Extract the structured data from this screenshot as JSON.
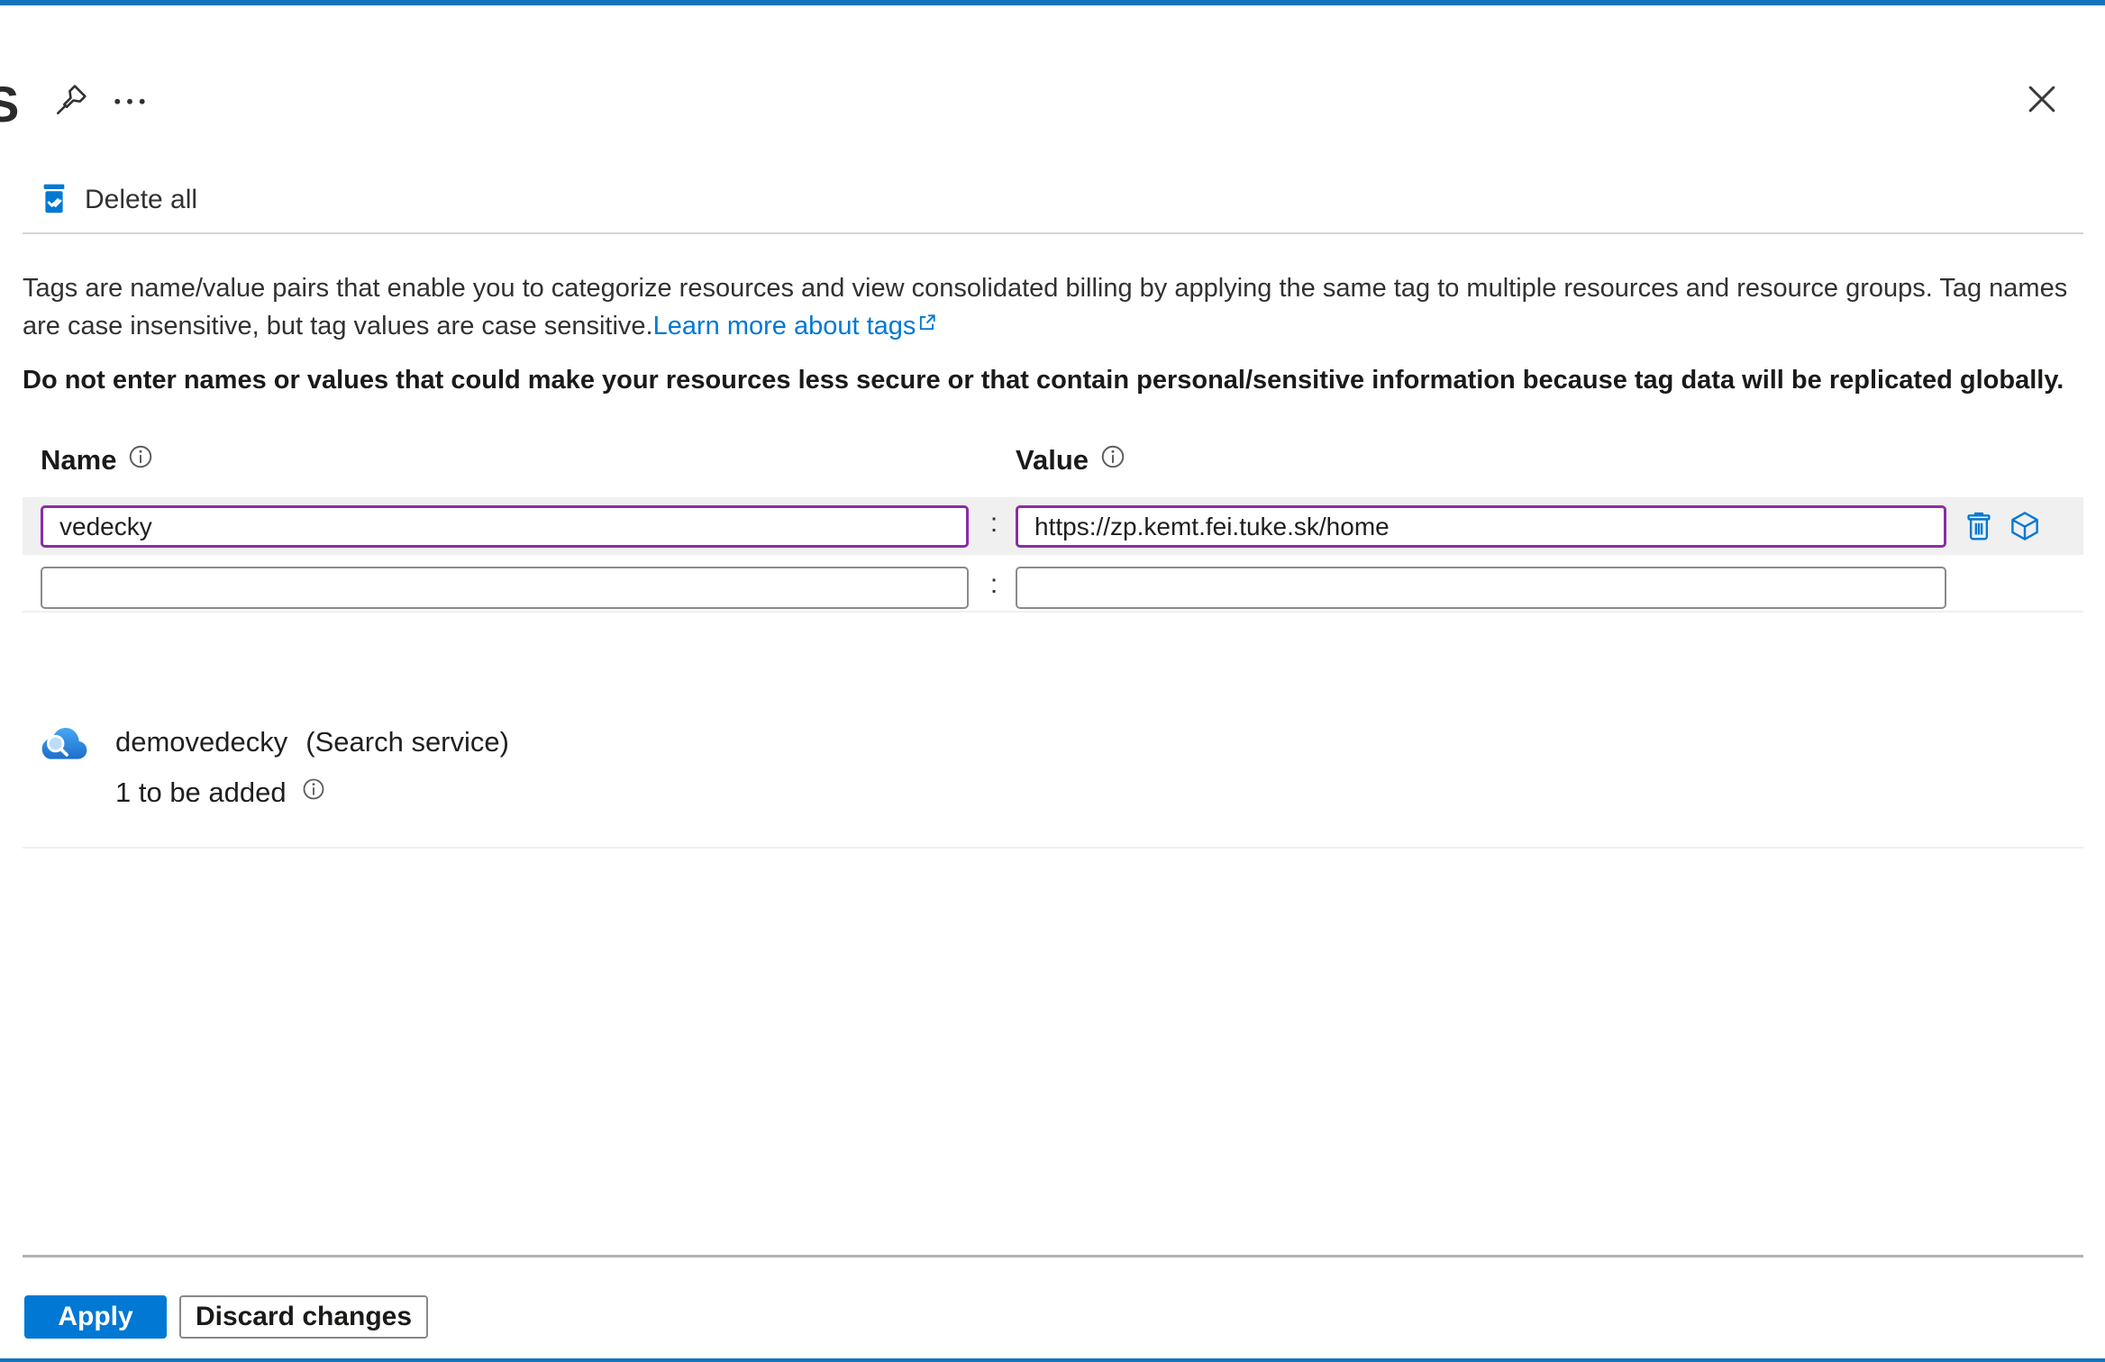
{
  "window": {
    "partial_title": "S",
    "topbar_color": "#1374bc",
    "accent_color": "#0078d4",
    "focused_border_color": "#8a2da5"
  },
  "toolbar": {
    "delete_all_label": "Delete all"
  },
  "description": {
    "text": "Tags are name/value pairs that enable you to categorize resources and view consolidated billing by applying the same tag to multiple resources and resource groups. Tag names are case insensitive, but tag values are case sensitive.",
    "link_label": "Learn more about tags",
    "warning": "Do not enter names or values that could make your resources less secure or that contain personal/sensitive information because tag data will be replicated globally."
  },
  "tag_editor": {
    "name_header": "Name",
    "value_header": "Value",
    "separator": ":",
    "rows": [
      {
        "name": "vedecky",
        "value": "https://zp.kemt.fei.tuke.sk/home"
      },
      {
        "name": "",
        "value": ""
      }
    ]
  },
  "resource": {
    "name": "demovedecky",
    "type": "(Search service)",
    "status": "1 to be added"
  },
  "footer": {
    "apply_label": "Apply",
    "discard_label": "Discard changes"
  }
}
